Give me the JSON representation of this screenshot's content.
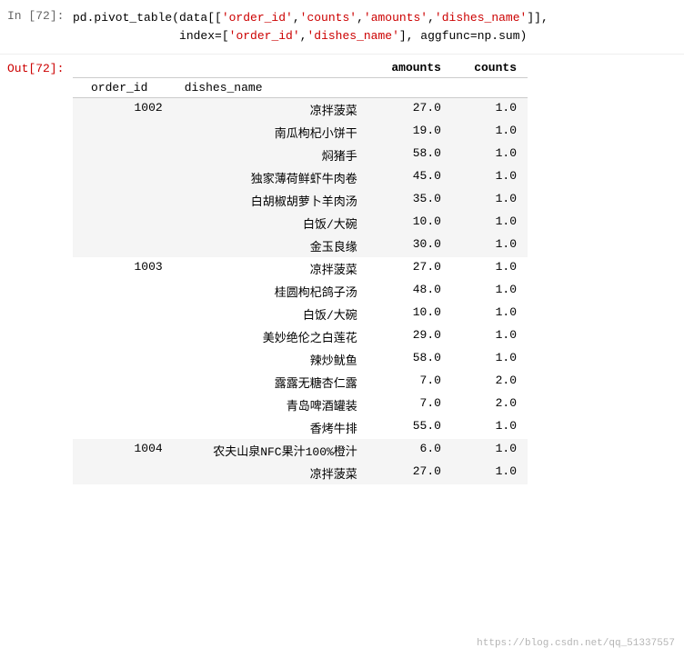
{
  "cell_input": {
    "label_in": "In",
    "label_num": "[72]:",
    "code_line1": "pd.pivot_table(data[['order_id','counts','amounts','dishes_name']],",
    "code_line2": "               index=['order_id','dishes_name'], aggfunc=np.sum)"
  },
  "cell_output": {
    "label_out": "Out[72]:",
    "columns": {
      "amounts": "amounts",
      "counts": "counts"
    },
    "index_headers": {
      "order_id": "order_id",
      "dishes_name": "dishes_name"
    },
    "rows": [
      {
        "order_id": "1002",
        "dish": "凉拌菠菜",
        "amounts": "27.0",
        "counts": "1.0",
        "group": "even"
      },
      {
        "order_id": "",
        "dish": "南瓜枸杞小饼干",
        "amounts": "19.0",
        "counts": "1.0",
        "group": "even"
      },
      {
        "order_id": "",
        "dish": "焖猪手",
        "amounts": "58.0",
        "counts": "1.0",
        "group": "even"
      },
      {
        "order_id": "",
        "dish": "独家薄荷鲜虾牛肉卷",
        "amounts": "45.0",
        "counts": "1.0",
        "group": "even"
      },
      {
        "order_id": "",
        "dish": "白胡椒胡萝卜羊肉汤",
        "amounts": "35.0",
        "counts": "1.0",
        "group": "even"
      },
      {
        "order_id": "",
        "dish": "白饭/大碗",
        "amounts": "10.0",
        "counts": "1.0",
        "group": "even"
      },
      {
        "order_id": "",
        "dish": "金玉良缘",
        "amounts": "30.0",
        "counts": "1.0",
        "group": "even"
      },
      {
        "order_id": "1003",
        "dish": "凉拌菠菜",
        "amounts": "27.0",
        "counts": "1.0",
        "group": "odd"
      },
      {
        "order_id": "",
        "dish": "桂圆枸杞鸽子汤",
        "amounts": "48.0",
        "counts": "1.0",
        "group": "odd"
      },
      {
        "order_id": "",
        "dish": "白饭/大碗",
        "amounts": "10.0",
        "counts": "1.0",
        "group": "odd"
      },
      {
        "order_id": "",
        "dish": "美妙绝伦之白莲花",
        "amounts": "29.0",
        "counts": "1.0",
        "group": "odd"
      },
      {
        "order_id": "",
        "dish": "辣炒鱿鱼",
        "amounts": "58.0",
        "counts": "1.0",
        "group": "odd"
      },
      {
        "order_id": "",
        "dish": "露露无糖杏仁露",
        "amounts": "7.0",
        "counts": "2.0",
        "group": "odd"
      },
      {
        "order_id": "",
        "dish": "青岛啤酒罐装",
        "amounts": "7.0",
        "counts": "2.0",
        "group": "odd"
      },
      {
        "order_id": "",
        "dish": "香烤牛排",
        "amounts": "55.0",
        "counts": "1.0",
        "group": "odd"
      },
      {
        "order_id": "1004",
        "dish": "农夫山泉NFC果汁100%橙汁",
        "amounts": "6.0",
        "counts": "1.0",
        "group": "even"
      },
      {
        "order_id": "",
        "dish": "凉拌菠菜",
        "amounts": "27.0",
        "counts": "1.0",
        "group": "even"
      }
    ]
  },
  "watermark": {
    "text": "https://blog.csdn.net/qq_51337557"
  }
}
